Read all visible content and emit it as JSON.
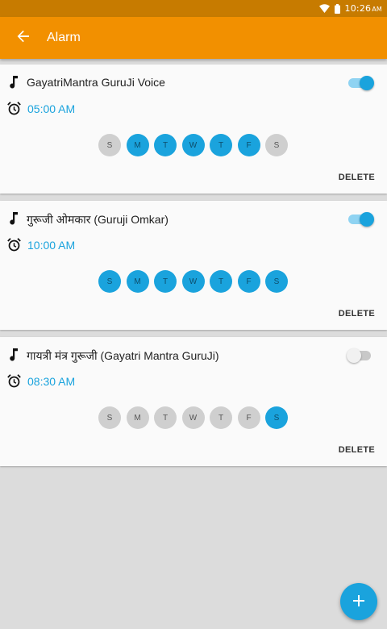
{
  "status_bar": {
    "time": "10:26",
    "ampm": "AM",
    "icons": [
      "wifi-icon",
      "battery-icon"
    ]
  },
  "app_bar": {
    "title": "Alarm",
    "back_icon": "arrow-back-icon"
  },
  "colors": {
    "accent": "#1aa3dd",
    "app_bar": "#f29000",
    "status_bar": "#c77b00",
    "day_off": "#cfcfcf"
  },
  "alarms": [
    {
      "name": "GayatriMantra GuruJi Voice",
      "time": "05:00 AM",
      "enabled": true,
      "days": [
        {
          "label": "S",
          "on": false
        },
        {
          "label": "M",
          "on": true
        },
        {
          "label": "T",
          "on": true
        },
        {
          "label": "W",
          "on": true
        },
        {
          "label": "T",
          "on": true
        },
        {
          "label": "F",
          "on": true
        },
        {
          "label": "S",
          "on": false
        }
      ],
      "delete_label": "DELETE"
    },
    {
      "name": "गुरूजी ओमकार (Guruji Omkar)",
      "time": "10:00 AM",
      "enabled": true,
      "days": [
        {
          "label": "S",
          "on": true
        },
        {
          "label": "M",
          "on": true
        },
        {
          "label": "T",
          "on": true
        },
        {
          "label": "W",
          "on": true
        },
        {
          "label": "T",
          "on": true
        },
        {
          "label": "F",
          "on": true
        },
        {
          "label": "S",
          "on": true
        }
      ],
      "delete_label": "DELETE"
    },
    {
      "name": "गायत्री मंत्र गुरूजी (Gayatri Mantra GuruJi)",
      "time": "08:30 AM",
      "enabled": false,
      "days": [
        {
          "label": "S",
          "on": false
        },
        {
          "label": "M",
          "on": false
        },
        {
          "label": "T",
          "on": false
        },
        {
          "label": "W",
          "on": false
        },
        {
          "label": "T",
          "on": false
        },
        {
          "label": "F",
          "on": false
        },
        {
          "label": "S",
          "on": true
        }
      ],
      "delete_label": "DELETE"
    }
  ],
  "fab": {
    "icon": "plus-icon"
  }
}
